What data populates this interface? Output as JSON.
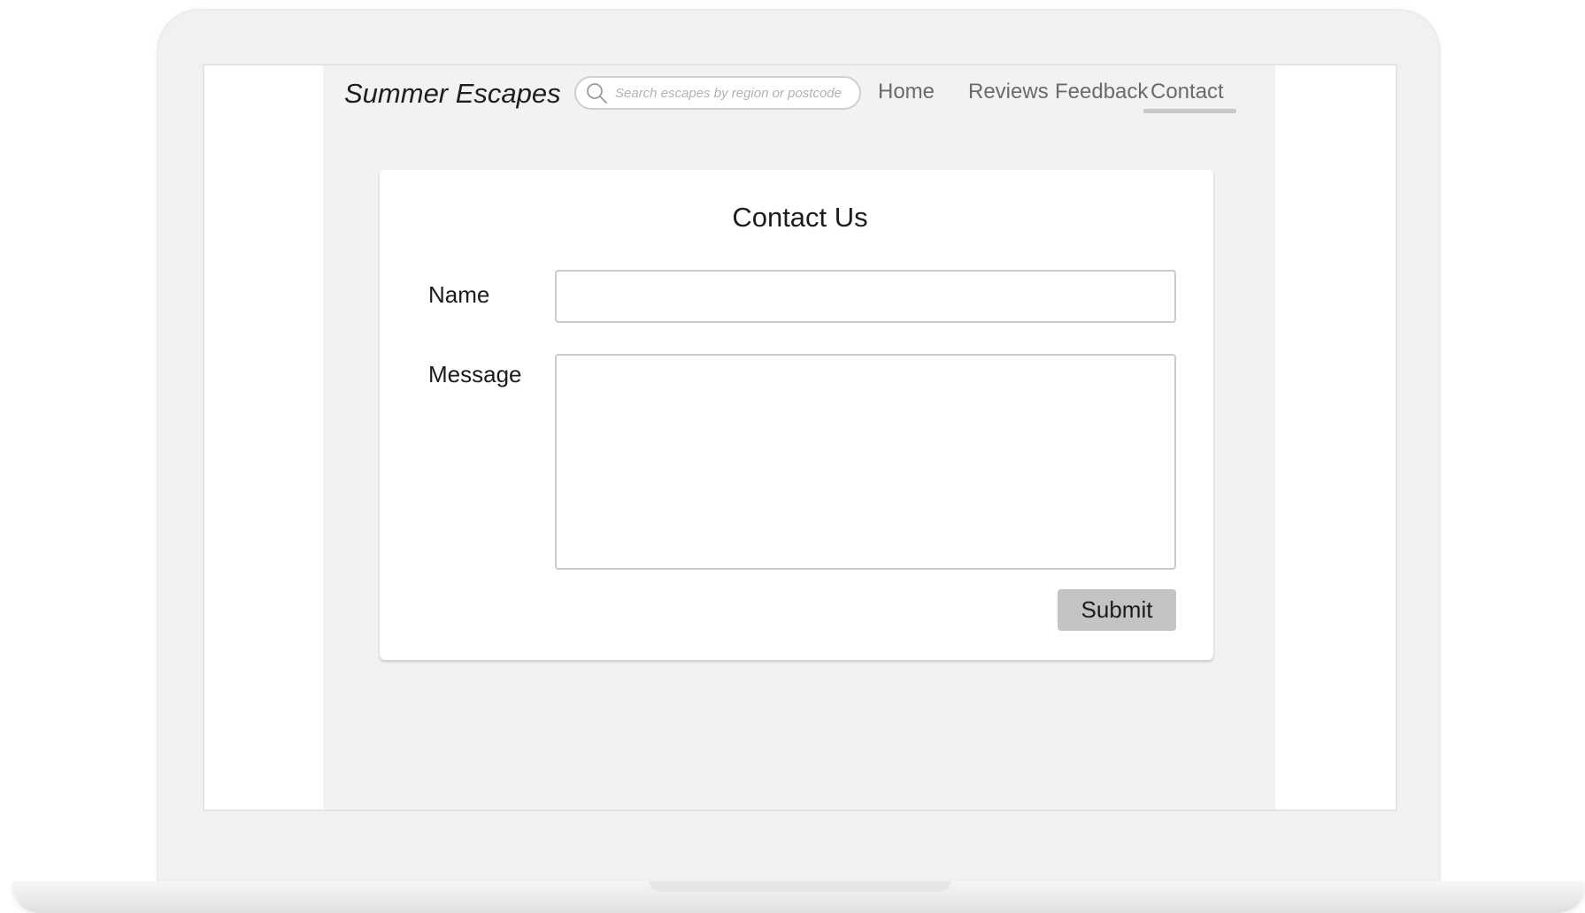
{
  "header": {
    "brand": "Summer Escapes",
    "search": {
      "placeholder": "Search escapes by region or postcode",
      "value": ""
    },
    "nav": [
      {
        "label": "Home",
        "active": false
      },
      {
        "label": "Reviews",
        "active": false
      },
      {
        "label": "Feedback",
        "active": false
      },
      {
        "label": "Contact",
        "active": true
      }
    ]
  },
  "contact_form": {
    "title": "Contact Us",
    "name_label": "Name",
    "name_value": "",
    "message_label": "Message",
    "message_value": "",
    "submit_label": "Submit"
  },
  "icons": {
    "search": "search-icon"
  },
  "colors": {
    "page_background": "#f2f2f2",
    "card_background": "#ffffff",
    "active_underline": "#c8c8c8",
    "button_background": "#c4c4c4",
    "nav_text": "#6b6b6b"
  }
}
